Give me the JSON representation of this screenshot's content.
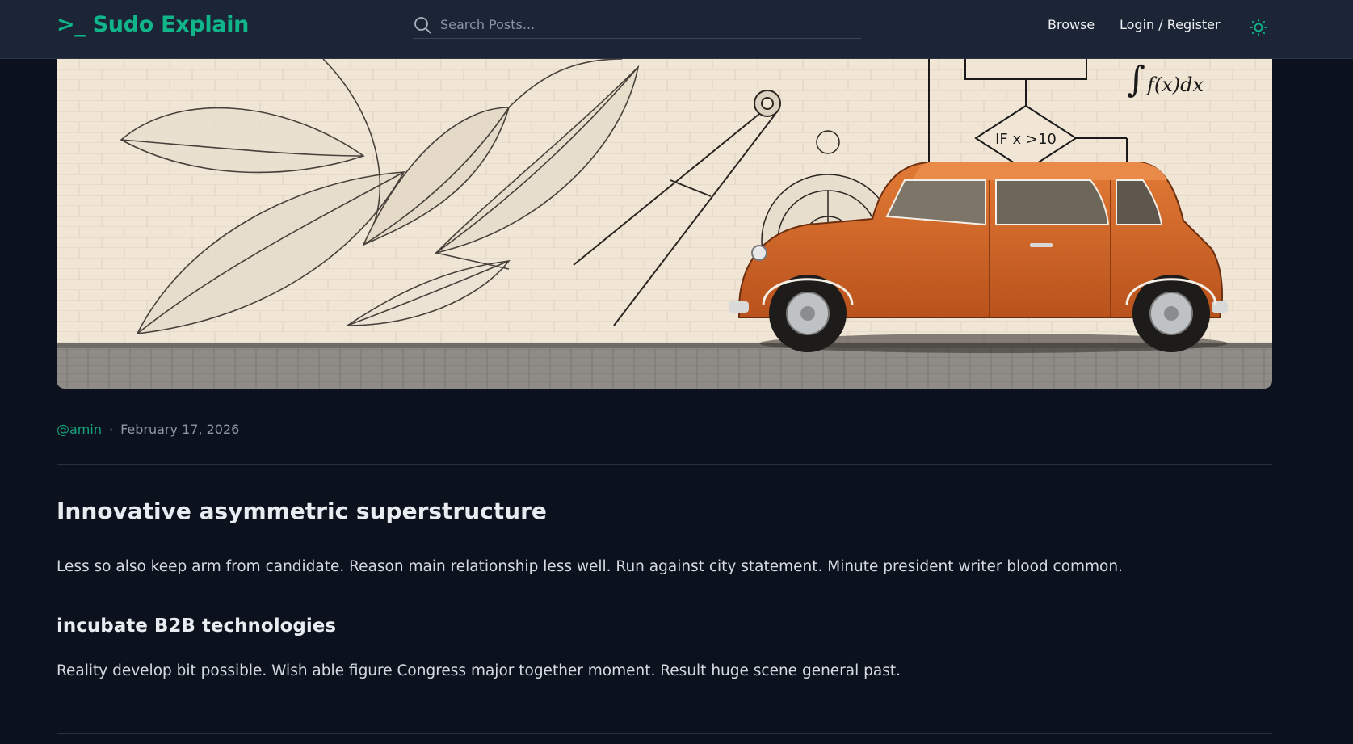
{
  "header": {
    "logo": ">_ Sudo Explain",
    "search_placeholder": "Search Posts...",
    "nav": {
      "browse": "Browse",
      "login": "Login / Register"
    },
    "icons": {
      "search": "search-icon",
      "theme": "sun-icon"
    }
  },
  "hero": {
    "formula_text": "f(x)dx",
    "flowchart_condition": "IF x >10"
  },
  "post": {
    "author": "@amin",
    "separator": "·",
    "date": "February 17, 2026",
    "title": "Innovative asymmetric superstructure",
    "intro": "Less so also keep arm from candidate. Reason main relationship less well. Run against city statement. Minute president writer blood common.",
    "subheading": "incubate B2B technologies",
    "body": "Reality develop bit possible. Wish able figure Congress major together moment. Result huge scene general past."
  },
  "colors": {
    "accent": "#10b58a",
    "header_bg": "#1b2535",
    "page_bg": "#0b111d",
    "car": "#d9692a"
  }
}
